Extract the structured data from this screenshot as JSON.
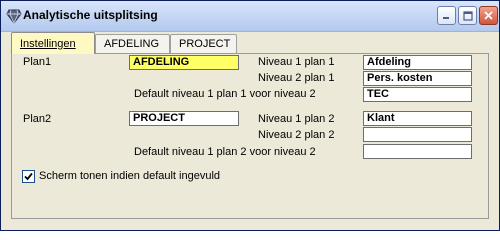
{
  "window": {
    "title": "Analytische uitsplitsing"
  },
  "tabs": [
    {
      "label": "Instellingen"
    },
    {
      "label": "AFDELING"
    },
    {
      "label": "PROJECT"
    }
  ],
  "plan1": {
    "label": "Plan1",
    "value": "AFDELING",
    "niveau1_label": "Niveau 1 plan 1",
    "niveau1_value": "Afdeling",
    "niveau2_label": "Niveau 2 plan 1",
    "niveau2_value": "Pers. kosten",
    "default_label": "Default niveau 1 plan 1 voor niveau 2",
    "default_value": "TEC"
  },
  "plan2": {
    "label": "Plan2",
    "value": "PROJECT",
    "niveau1_label": "Niveau 1 plan 2",
    "niveau1_value": "Klant",
    "niveau2_label": "Niveau 2 plan 2",
    "niveau2_value": "",
    "default_label": "Default niveau 1 plan 2 voor niveau 2",
    "default_value": ""
  },
  "checkbox": {
    "label": "Scherm tonen indien default ingevuld",
    "checked": true
  }
}
